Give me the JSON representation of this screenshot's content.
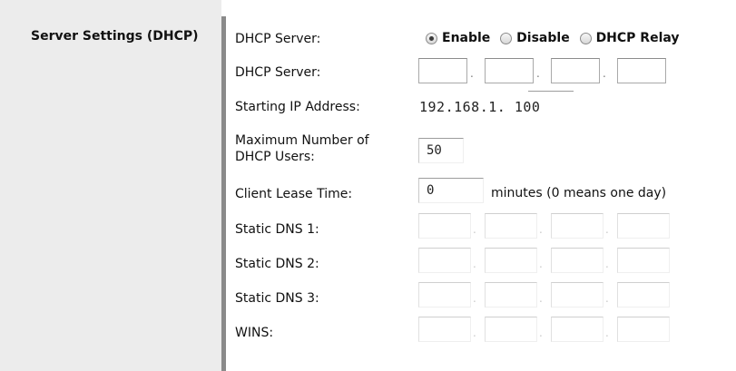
{
  "section": {
    "title": "Server Settings (DHCP)"
  },
  "dhcp_server_mode": {
    "label": "DHCP Server:",
    "options": [
      "Enable",
      "Disable",
      "DHCP Relay"
    ],
    "selected": "Enable"
  },
  "dhcp_server_ip": {
    "label": "DHCP Server:",
    "octets": [
      "",
      "",
      "",
      ""
    ]
  },
  "starting_ip": {
    "label": "Starting IP Address:",
    "prefix": "192.168.1.",
    "last_octet": "100"
  },
  "max_users": {
    "label_line1": "Maximum Number of",
    "label_line2": "DHCP Users:",
    "value": "50"
  },
  "lease_time": {
    "label": "Client Lease Time:",
    "value": "0",
    "suffix": "minutes (0 means one day)"
  },
  "static_dns_1": {
    "label": "Static DNS 1:",
    "octets": [
      "",
      "",
      "",
      ""
    ]
  },
  "static_dns_2": {
    "label": "Static DNS 2:",
    "octets": [
      "",
      "",
      "",
      ""
    ]
  },
  "static_dns_3": {
    "label": "Static DNS 3:",
    "octets": [
      "",
      "",
      "",
      ""
    ]
  },
  "wins": {
    "label": "WINS:",
    "octets": [
      "",
      "",
      "",
      ""
    ]
  },
  "colors": {
    "left_panel": "#ececec",
    "divider": "#8a8a8a"
  }
}
